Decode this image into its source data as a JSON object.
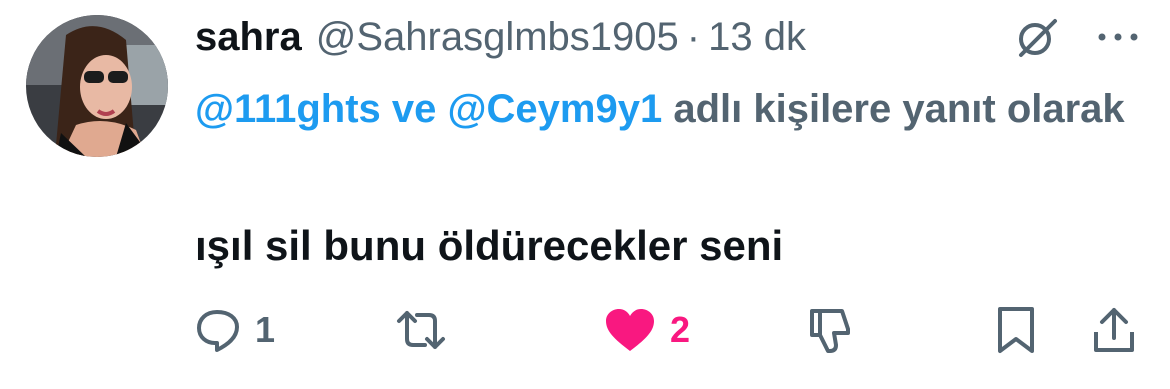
{
  "user": {
    "display_name": "sahra",
    "handle": "@Sahrasglmbs1905",
    "separator": "·",
    "time": "13 dk"
  },
  "reply_context": {
    "mention_1": "@111ghts",
    "connector": "ve",
    "mention_2": "@Ceym9y1",
    "suffix": "adlı kişilere yanıt olarak"
  },
  "tweet": {
    "text": "ışıl sil bunu öldürecekler seni"
  },
  "actions": {
    "reply_count": "1",
    "like_count": "2"
  },
  "colors": {
    "accent": "#1d9bf0",
    "like": "#f91880",
    "secondary": "#536471",
    "primary": "#0f1419"
  },
  "icons": [
    "grok-icon",
    "more-icon",
    "reply-icon",
    "retweet-icon",
    "heart-filled-icon",
    "dislike-icon",
    "bookmark-icon",
    "share-icon"
  ]
}
